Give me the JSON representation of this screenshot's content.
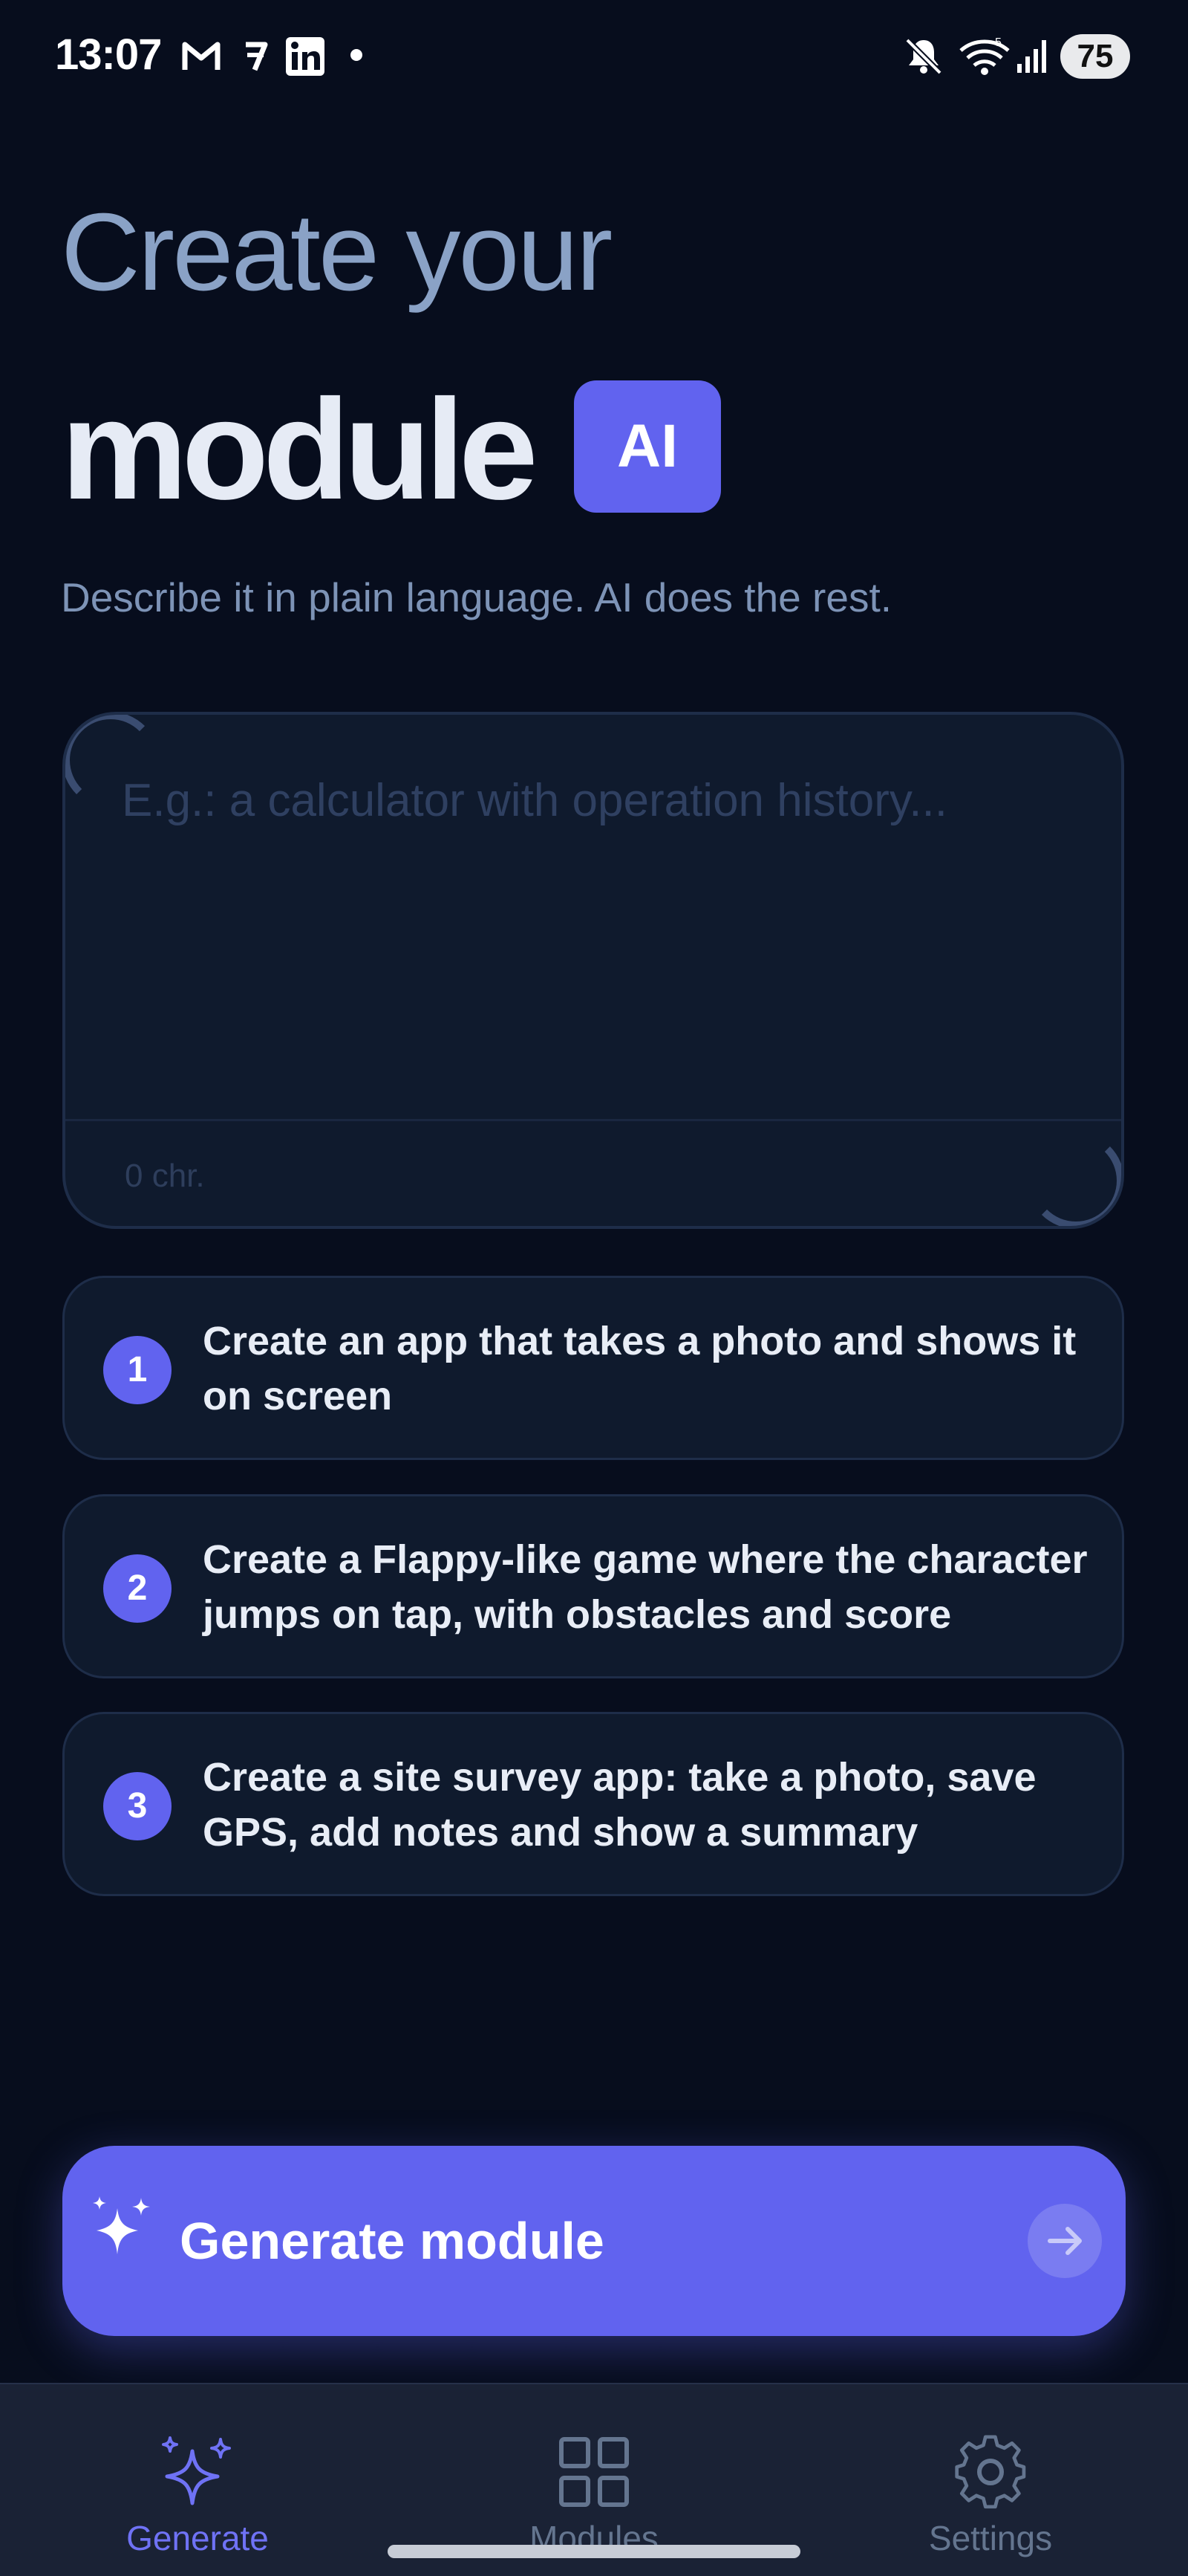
{
  "status_bar": {
    "time": "13:07",
    "notification_icons": [
      "gmail-icon",
      "app-notification-icon",
      "linkedin-icon",
      "dot-icon"
    ],
    "system_icons": [
      "mute-icon",
      "wifi-icon",
      "signal-icon"
    ],
    "wifi_tag": "5",
    "battery": "75"
  },
  "header": {
    "line1": "Create your",
    "line2": "module",
    "badge": "AI",
    "subtitle": "Describe it in plain language. AI does the rest."
  },
  "prompt": {
    "value": "",
    "placeholder": "E.g.: a calculator with operation history...",
    "char_count": "0 chr."
  },
  "suggestions": [
    {
      "number": "1",
      "text": "Create an app that takes a photo and shows it on screen"
    },
    {
      "number": "2",
      "text": "Create a Flappy-like game where the character jumps on tap, with obstacles and score"
    },
    {
      "number": "3",
      "text": "Create a site survey app: take a photo, save GPS, add notes and show a summary"
    }
  ],
  "generate_button": {
    "label": "Generate module",
    "icon": "sparkles-icon",
    "trailing_icon": "arrow-right-icon"
  },
  "nav": {
    "items": [
      {
        "label": "Generate",
        "icon": "sparkles-icon",
        "active": true
      },
      {
        "label": "Modules",
        "icon": "grid-icon",
        "active": false
      },
      {
        "label": "Settings",
        "icon": "gear-icon",
        "active": false
      }
    ]
  },
  "colors": {
    "background": "#070d1d",
    "accent": "#6163ef",
    "card": "#0f1a2d",
    "muted_text": "#7d93b6",
    "nav_background": "#1a2235"
  }
}
